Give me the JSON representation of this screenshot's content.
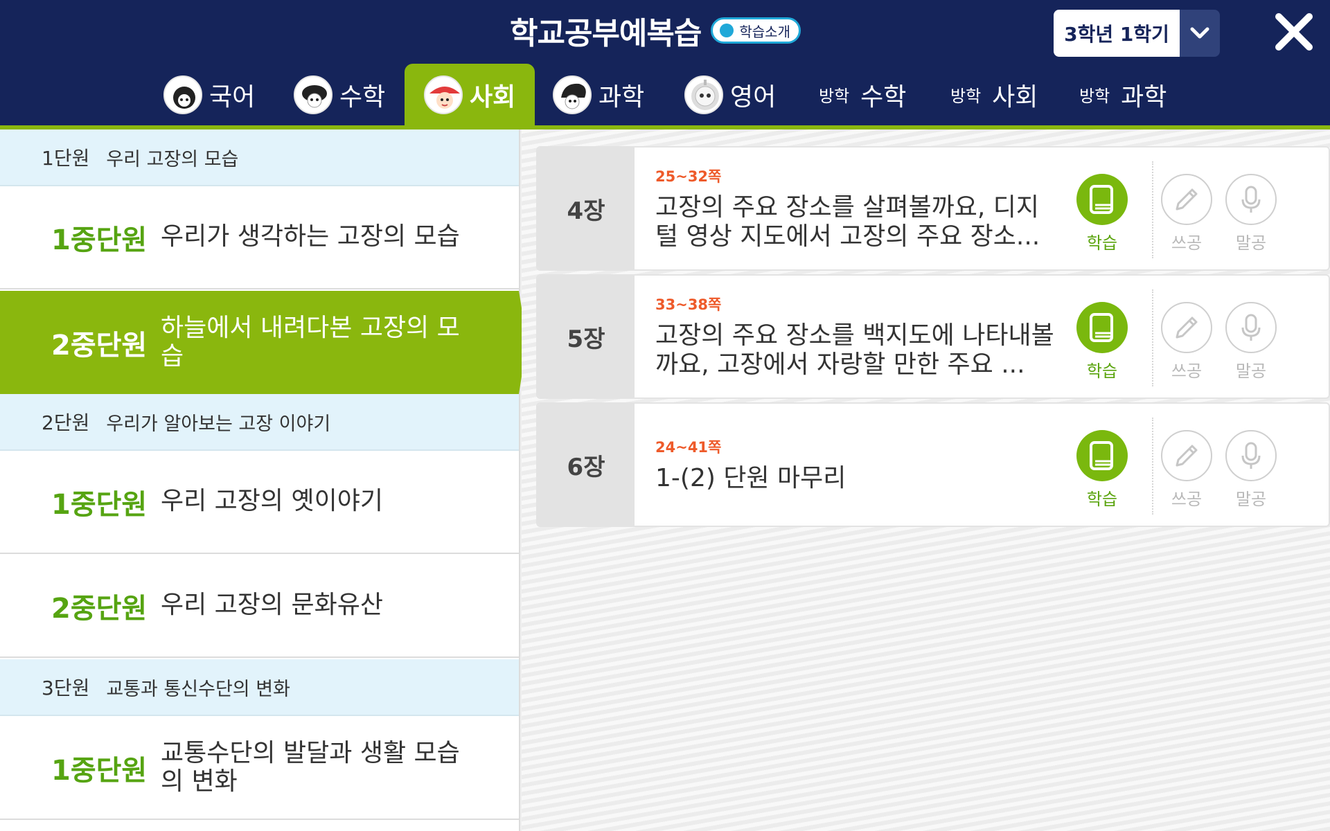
{
  "header": {
    "title": "학교공부예복습",
    "intro_badge": "학습소개",
    "semester": "3학년 1학기"
  },
  "tabs": [
    {
      "label": "국어",
      "prefix": "",
      "active": false,
      "has_avatar": true
    },
    {
      "label": "수학",
      "prefix": "",
      "active": false,
      "has_avatar": true
    },
    {
      "label": "사회",
      "prefix": "",
      "active": true,
      "has_avatar": true
    },
    {
      "label": "과학",
      "prefix": "",
      "active": false,
      "has_avatar": true
    },
    {
      "label": "영어",
      "prefix": "",
      "active": false,
      "has_avatar": true
    },
    {
      "label": "수학",
      "prefix": "방학",
      "active": false,
      "has_avatar": false
    },
    {
      "label": "사회",
      "prefix": "방학",
      "active": false,
      "has_avatar": false
    },
    {
      "label": "과학",
      "prefix": "방학",
      "active": false,
      "has_avatar": false
    }
  ],
  "sidebar": {
    "units": [
      {
        "num": "1단원",
        "title": "우리 고장의 모습"
      },
      {
        "num": "2단원",
        "title": "우리가 알아보는 고장 이야기"
      },
      {
        "num": "3단원",
        "title": "교통과 통신수단의 변화"
      }
    ],
    "subunits": [
      {
        "num": "1중단원",
        "title": "우리가 생각하는 고장의 모습",
        "active": false
      },
      {
        "num": "2중단원",
        "title": "하늘에서 내려다본 고장의 모습",
        "active": true
      },
      {
        "num": "1중단원",
        "title": "우리 고장의 옛이야기",
        "active": false
      },
      {
        "num": "2중단원",
        "title": "우리 고장의 문화유산",
        "active": false
      },
      {
        "num": "1중단원",
        "title": "교통수단의 발달과 생활 모습의 변화",
        "active": false
      }
    ]
  },
  "lessons": [
    {
      "chapter": "4장",
      "pages": "25~32쪽",
      "title": "고장의 주요 장소를 살펴볼까요, 디지털 영상 지도에서 고장의 주요 장소..."
    },
    {
      "chapter": "5장",
      "pages": "33~38쪽",
      "title": "고장의 주요 장소를 백지도에 나타내볼까요, 고장에서 자랑할 만한 주요 ..."
    },
    {
      "chapter": "6장",
      "pages": "24~41쪽",
      "title": "1-(2) 단원 마무리"
    }
  ],
  "actions": {
    "study": "학습",
    "write": "쓰공",
    "speak": "말공"
  },
  "colors": {
    "header_bg": "#15245a",
    "accent_green": "#8ab70e",
    "subunit_green": "#56a412",
    "page_orange": "#ee5a2a",
    "unit_bg": "#e2f3fb"
  }
}
